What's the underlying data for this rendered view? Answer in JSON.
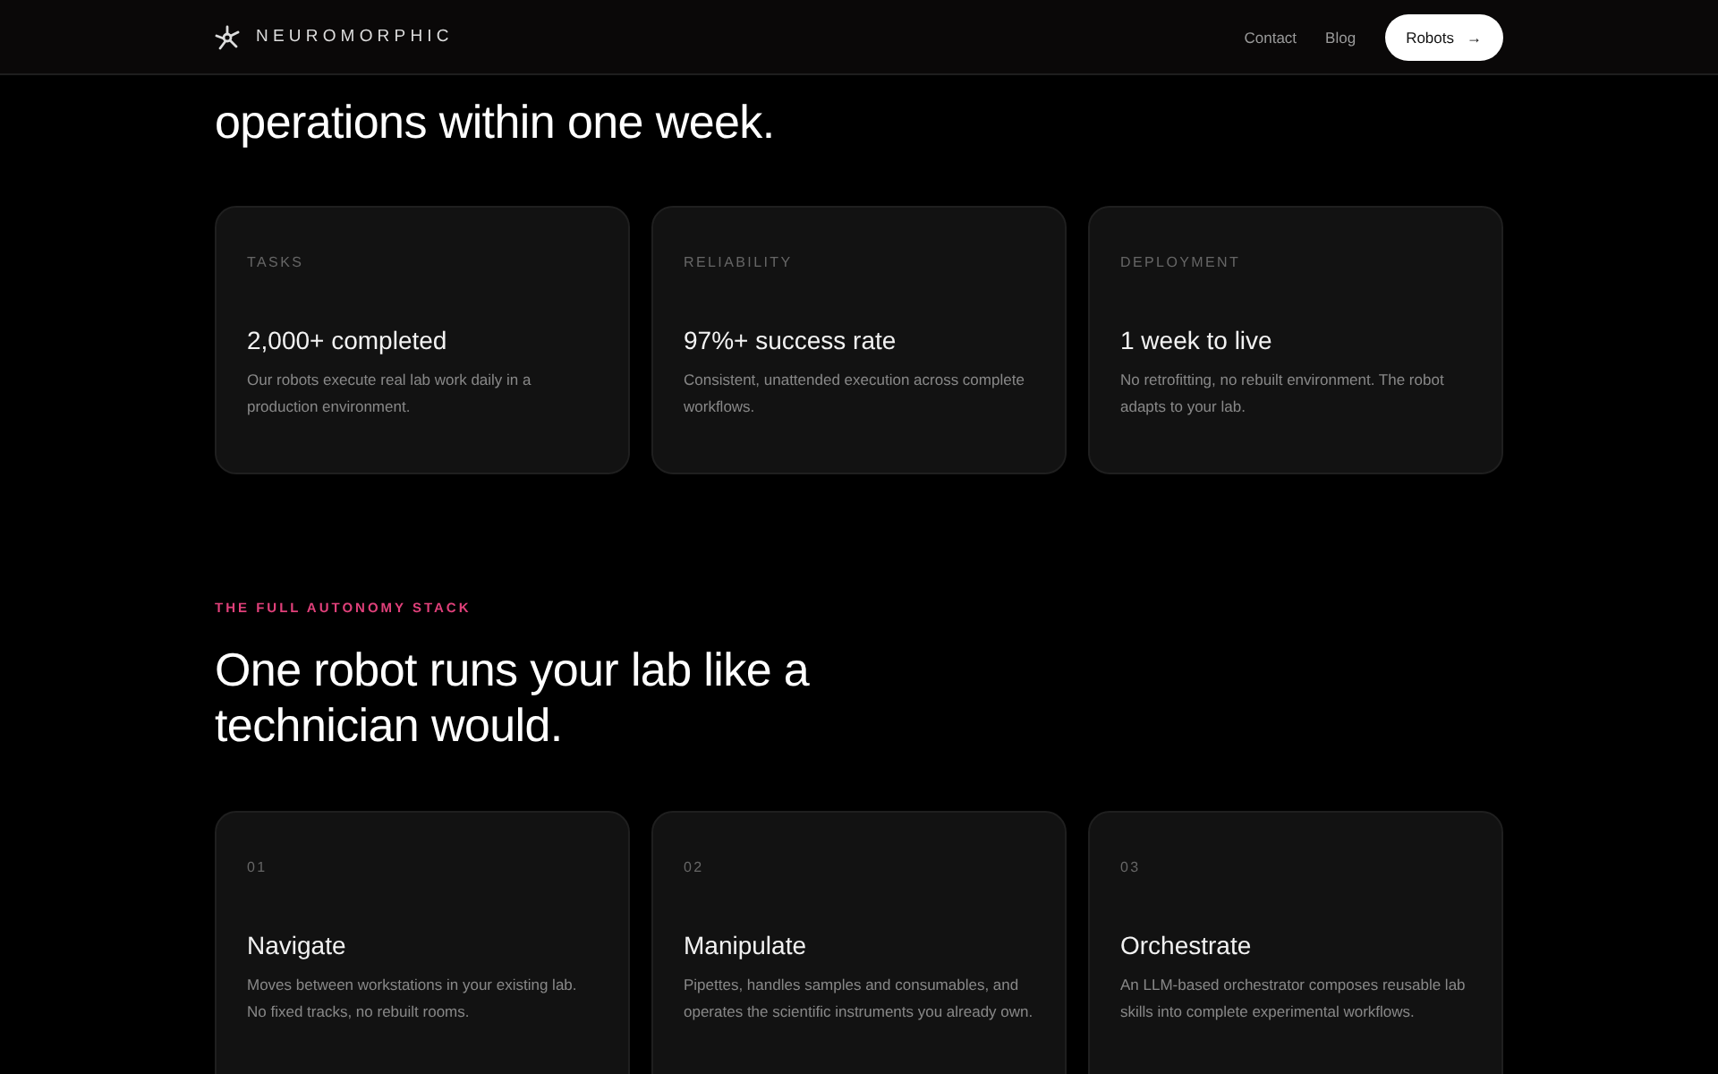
{
  "header": {
    "brand": "NEUROMORPHIC",
    "nav": [
      {
        "label": "Contact"
      },
      {
        "label": "Blog"
      }
    ],
    "cta": {
      "label": "Robots",
      "arrow": "→"
    }
  },
  "intro": {
    "heading_lines": [
      "operations within one week."
    ]
  },
  "stats": [
    {
      "label": "TASKS",
      "value": "2,000+ completed",
      "description": "Our robots execute real lab work daily in a production environment."
    },
    {
      "label": "RELIABILITY",
      "value": "97%+ success rate",
      "description": "Consistent, unattended execution across complete workflows."
    },
    {
      "label": "DEPLOYMENT",
      "value": "1 week to live",
      "description": "No retrofitting, no rebuilt environment. The robot adapts to your lab."
    }
  ],
  "stack": {
    "eyebrow": "THE FULL AUTONOMY STACK",
    "heading_lines": [
      "One robot runs your lab like a",
      "technician would."
    ],
    "items": [
      {
        "number": "01",
        "title": "Navigate",
        "description": "Moves between workstations in your existing lab. No fixed tracks, no rebuilt rooms."
      },
      {
        "number": "02",
        "title": "Manipulate",
        "description": "Pipettes, handles samples and consumables, and operates the scientific instruments you already own."
      },
      {
        "number": "03",
        "title": "Orchestrate",
        "description": "An LLM-based orchestrator composes reusable lab skills into complete experimental workflows."
      }
    ]
  }
}
